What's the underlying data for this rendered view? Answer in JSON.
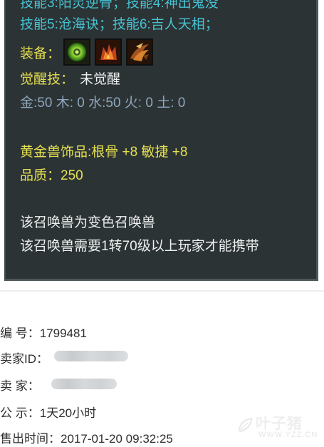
{
  "tooltip": {
    "cut_line": "技能3:阳灵逆骨；技能4:神出鬼没",
    "skills_line": "技能5:沧海诀；技能6:吉人天相；",
    "equip_label": "装备：",
    "equip_icons": [
      "green-orb-item-icon",
      "flame-armor-item-icon",
      "claw-item-icon"
    ],
    "awaken_label": "觉醒技：",
    "awaken_value": "未觉醒",
    "elements": "金:50 木: 0 水:50 火: 0 土: 0",
    "accessory": "黄金兽饰品:根骨 +8 敏捷 +8",
    "quality_label": "品质：",
    "quality_value": "250",
    "note1": "该召唤兽为变色召唤兽",
    "note2": "该召唤兽需要1转70级以上玩家才能携带"
  },
  "info": {
    "number_label": "编  号：",
    "number_value": "1799481",
    "seller_id_label": "卖家ID：",
    "seller_label": "卖  家：",
    "notice_label": "公  示：",
    "notice_value": "1天20小时",
    "sold_time_label": "售出时间：",
    "sold_time_value": "2017-01-20 09:32:25"
  },
  "watermark": {
    "main": "叶子猪",
    "sub": "WWW.YZZ.CN"
  },
  "colors": {
    "tooltip_bg": "#2c3335",
    "skill_cyan": "#47c2d2",
    "label_yellow": "#e4e050",
    "element_blue": "#8fa6bd"
  }
}
